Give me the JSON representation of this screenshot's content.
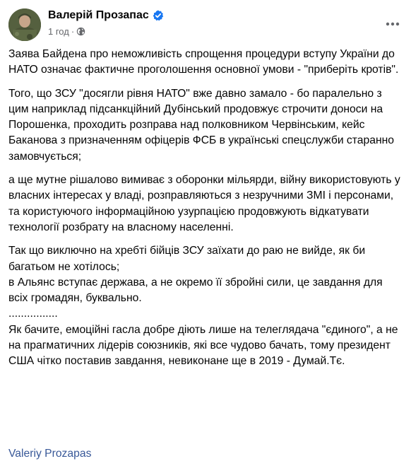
{
  "post": {
    "author_name": "Валерій Прозапас",
    "verified_icon": "verified-badge-icon",
    "timestamp": "1 год",
    "separator": "·",
    "audience_icon": "globe-icon",
    "more_icon": "more-options-icon",
    "paragraphs": [
      "Заява Байдена про неможливість спрощення процедури вступу України до НАТО означає фактичне проголошення основної умови - \"приберіть кротів\".",
      "Того, що ЗСУ \"досягли рівня НАТО\" вже давно замало - бо паралельно з цим наприклад підсанкційний Дубінський продовжує строчити доноси на Порошенка, проходить розправа над полковником Червінським, кейс Баканова з призначенням офіцерів ФСБ в українські спецслужби старанно замовчується;",
      "а ще мутне рішалово вимиває з оборонки мільярди, війну використовують у власних інтересах у владі, розправляються з незручними ЗМІ і персонами, та користуючого інформаційною узурпацією продовжують відкатувати технології розбрату на власному населенні.",
      "Так що виключно на хребті бійців ЗСУ заїхати до раю не вийде, як би багатьом не хотілось;\nв Альянс вступає держава, а не окремо її збройні сили, це завдання для всіх громадян, буквально.\n................",
      "Як бачите, емоційні гасла добре діють лише на телеглядача \"єдиного\", а не на прагматичних лідерів союзників, які все чудово бачать, тому президент США чітко поставив завдання, невиконане ще в 2019 - Думай.Тє."
    ],
    "signature": "Valeriy Prozapas"
  },
  "colors": {
    "text": "#050505",
    "meta": "#65676b",
    "link": "#385898",
    "verified": "#1877f2"
  }
}
